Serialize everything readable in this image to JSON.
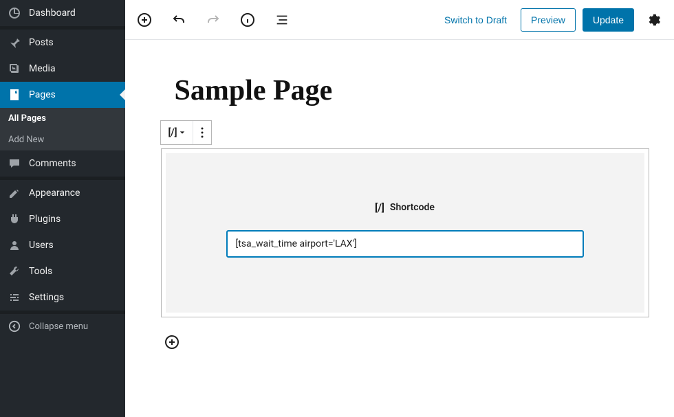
{
  "sidebar": {
    "items": [
      {
        "label": "Dashboard"
      },
      {
        "label": "Posts"
      },
      {
        "label": "Media"
      },
      {
        "label": "Pages"
      },
      {
        "label": "Comments"
      },
      {
        "label": "Appearance"
      },
      {
        "label": "Plugins"
      },
      {
        "label": "Users"
      },
      {
        "label": "Tools"
      },
      {
        "label": "Settings"
      }
    ],
    "submenu": {
      "all_pages": "All Pages",
      "add_new": "Add New"
    },
    "collapse": "Collapse menu"
  },
  "topbar": {
    "switch_draft": "Switch to Draft",
    "preview": "Preview",
    "update": "Update"
  },
  "editor": {
    "page_title": "Sample Page",
    "block_label": "Shortcode",
    "shortcode_value": "[tsa_wait_time airport='LAX']"
  }
}
